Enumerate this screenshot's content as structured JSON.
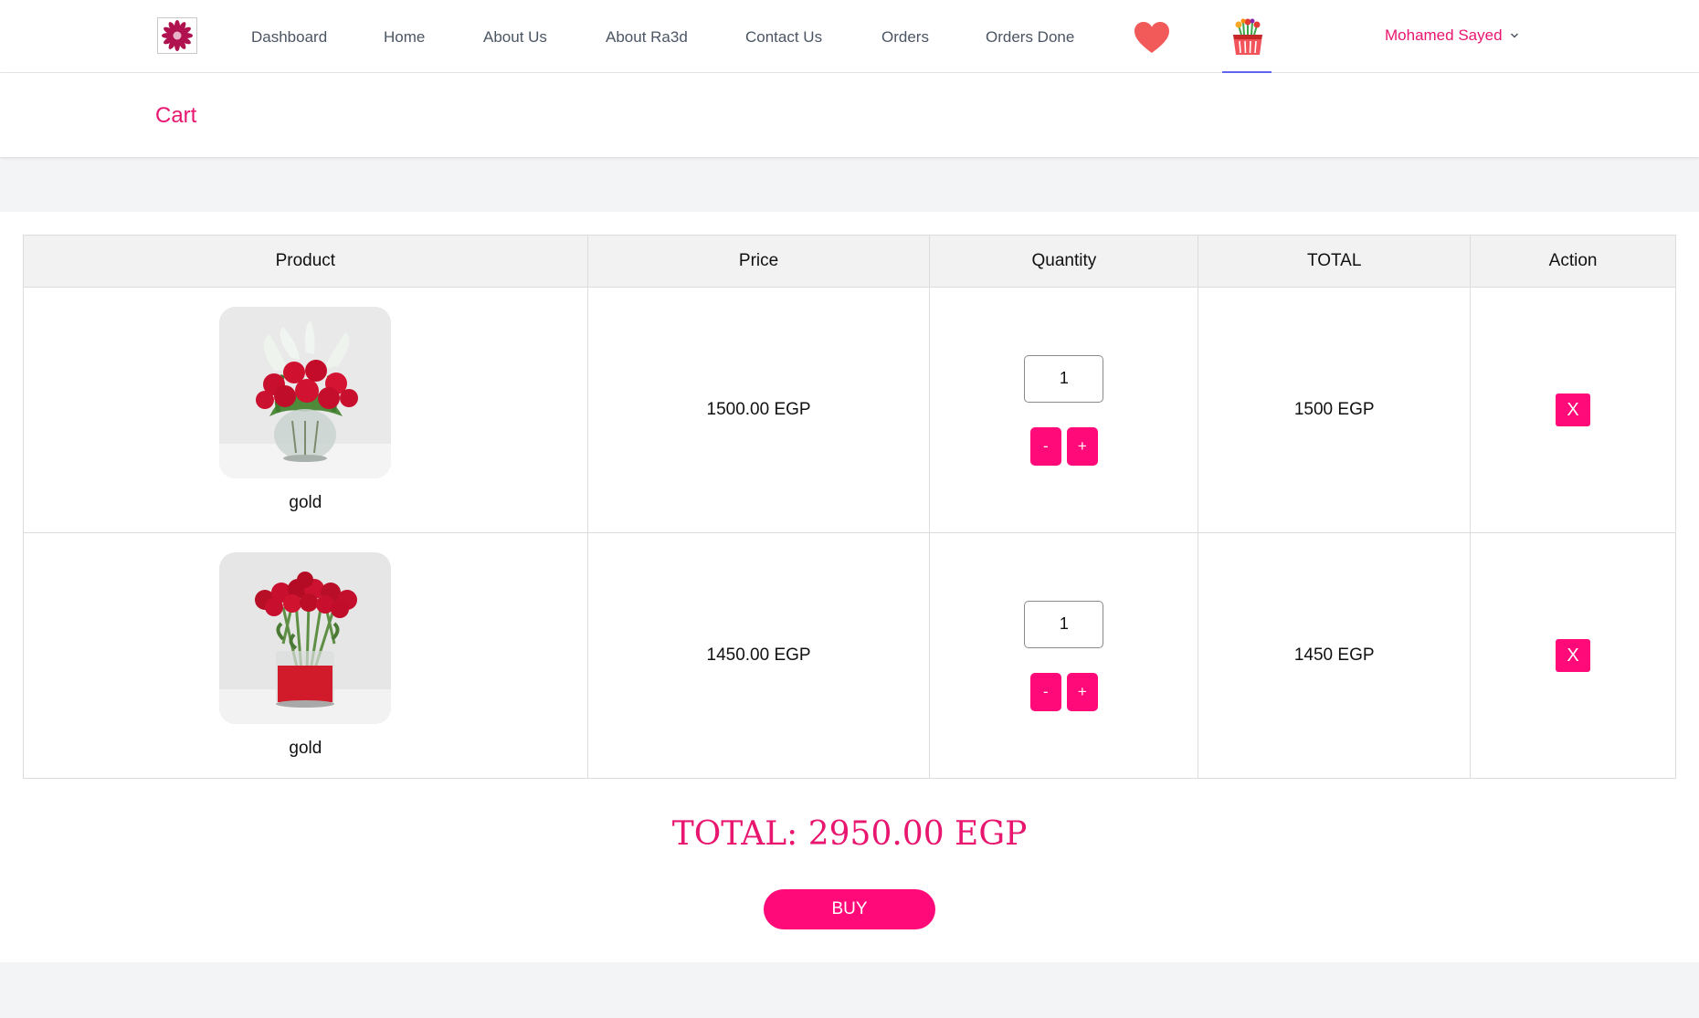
{
  "nav": {
    "links": [
      "Dashboard",
      "Home",
      "About Us",
      "About Ra3d",
      "Contact Us",
      "Orders",
      "Orders Done"
    ],
    "user_name": "Mohamed Sayed",
    "icons": {
      "logo": "flower-logo-icon",
      "favorites": "heart-icon",
      "cart": "flower-basket-icon",
      "user_menu": "chevron-down-icon"
    },
    "active": "cart"
  },
  "page": {
    "title": "Cart"
  },
  "cart": {
    "headers": [
      "Product",
      "Price",
      "Quantity",
      "TOTAL",
      "Action"
    ],
    "items": [
      {
        "name": "gold",
        "image": "red-roses-and-white-lilies-bouquet-in-glass-vase",
        "price": "1500.00 EGP",
        "quantity": "1",
        "total": "1500 EGP",
        "decrement": "-",
        "increment": "+",
        "remove": "X"
      },
      {
        "name": "gold",
        "image": "red-roses-in-cylinder-vase",
        "price": "1450.00 EGP",
        "quantity": "1",
        "total": "1450 EGP",
        "decrement": "-",
        "increment": "+",
        "remove": "X"
      }
    ],
    "grand_total": "TOTAL: 2950.00 EGP",
    "buy_label": "BUY"
  },
  "colors": {
    "accent": "#ff0a78",
    "accent_text": "#e8166f",
    "active_tab": "#6366f1",
    "heart": "#f25a5a"
  }
}
